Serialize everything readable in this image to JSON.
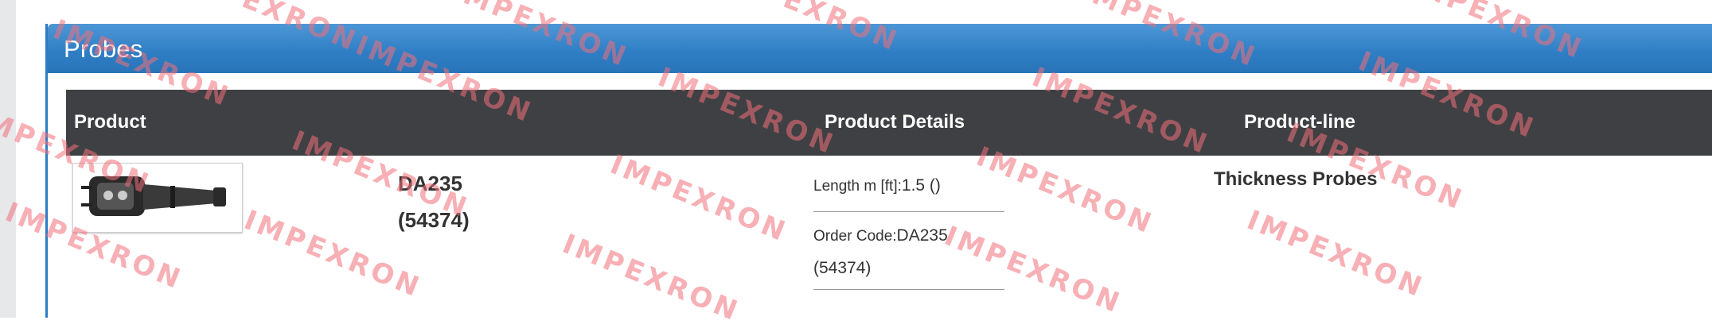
{
  "panel": {
    "title": "Probes"
  },
  "table": {
    "headers": {
      "product": "Product",
      "details": "Product Details",
      "product_line": "Product-line"
    },
    "row": {
      "name_line1": "DA235",
      "name_line2": "(54374)",
      "length_label": "Length m [ft]:",
      "length_value": "1.5 ()",
      "order_label": "Order Code:",
      "order_value": "DA235",
      "order_value_cont": "(54374)",
      "product_line": "Thickness Probes"
    }
  },
  "watermark": {
    "text": "IMPEXRON"
  },
  "colors": {
    "header_blue": "#2e7dc4",
    "table_head": "#3f4043",
    "watermark": "#f1707a"
  }
}
